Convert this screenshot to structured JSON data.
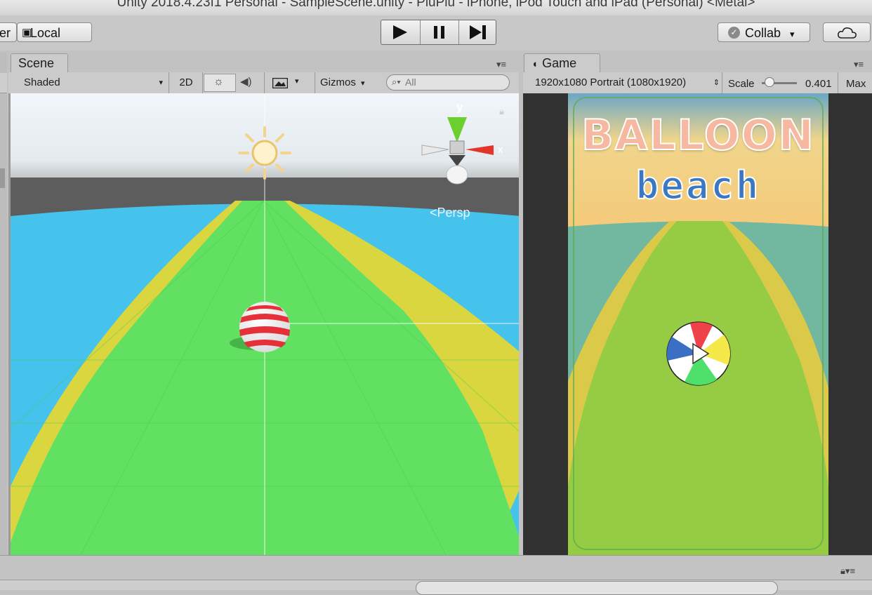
{
  "window": {
    "title": "Unity 2018.4.23f1 Personal - SampleScene.unity - PluPlu - iPhone, iPod Touch and iPad (Personal) <Metal>"
  },
  "toolbar": {
    "pivot_label": "er",
    "local_label": "Local",
    "collab_label": "Collab",
    "collab_arrow": "▾",
    "play_icon": "play-icon",
    "pause_icon": "pause-icon",
    "step_icon": "step-icon"
  },
  "scene": {
    "tab_label": "Scene",
    "shading_mode": "Shaded",
    "twod_label": "2D",
    "gizmos_label": "Gizmos",
    "search_placeholder": "All",
    "projection_label": "Persp",
    "gizmo_y_label": "y",
    "gizmo_x_label": "x"
  },
  "game": {
    "tab_label": "Game",
    "resolution_label": "1920x1080 Portrait (1080x1920)",
    "scale_label": "Scale",
    "scale_value": "0.401",
    "maximize_label": "Max",
    "scale_slider_fraction": 0.1
  },
  "game_view": {
    "title_line1": "BALLOON",
    "title_line2": "beach"
  },
  "colors": {
    "editor_bg": "#c2c2c2",
    "sky_top": "#ffffff",
    "horizon": "#5c5c5c",
    "water": "#45c3ec",
    "sand": "#d9d640",
    "grass": "#62e062",
    "title_blue": "#3b78c4"
  }
}
